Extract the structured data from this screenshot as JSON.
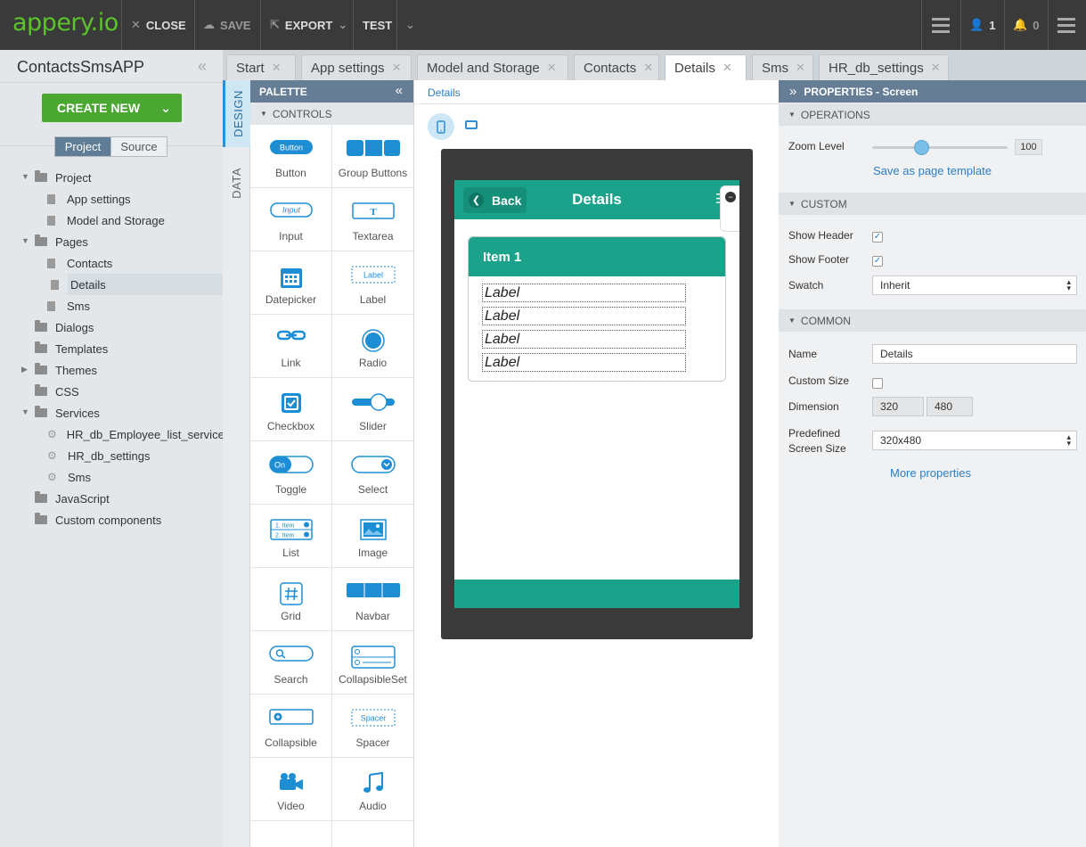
{
  "topbar": {
    "logo": "appery.io",
    "close": "CLOSE",
    "save": "SAVE",
    "export": "EXPORT",
    "test": "TEST",
    "users_count": "1",
    "notifications_count": "0"
  },
  "tabs": [
    "Start",
    "App settings",
    "Model and Storage",
    "Contacts",
    "Details",
    "Sms",
    "HR_db_settings"
  ],
  "active_tab": "Details",
  "sidebar": {
    "project_name": "ContactsSmsAPP",
    "create_new": "CREATE NEW",
    "seg_project": "Project",
    "seg_source": "Source",
    "tree": [
      {
        "label": "Project",
        "type": "folder",
        "expanded": true
      },
      {
        "label": "App settings",
        "type": "doc"
      },
      {
        "label": "Model and Storage",
        "type": "doc"
      },
      {
        "label": "Pages",
        "type": "folder",
        "expanded": true
      },
      {
        "label": "Contacts",
        "type": "doc"
      },
      {
        "label": "Details",
        "type": "doc",
        "selected": true
      },
      {
        "label": "Sms",
        "type": "doc"
      },
      {
        "label": "Dialogs",
        "type": "folder"
      },
      {
        "label": "Templates",
        "type": "folder"
      },
      {
        "label": "Themes",
        "type": "folder",
        "collapsed": true
      },
      {
        "label": "CSS",
        "type": "folder"
      },
      {
        "label": "Services",
        "type": "folder",
        "expanded": true
      },
      {
        "label": "HR_db_Employee_list_service",
        "type": "gear"
      },
      {
        "label": "HR_db_settings",
        "type": "gear"
      },
      {
        "label": "Sms",
        "type": "gear"
      },
      {
        "label": "JavaScript",
        "type": "folder"
      },
      {
        "label": "Custom components",
        "type": "folder"
      }
    ]
  },
  "vtabs": {
    "design": "DESIGN",
    "data": "DATA"
  },
  "palette": {
    "title": "PALETTE",
    "section": "CONTROLS",
    "items": [
      {
        "label": "Button",
        "icon": "button-icon"
      },
      {
        "label": "Group Buttons",
        "icon": "group-buttons-icon"
      },
      {
        "label": "Input",
        "icon": "input-icon"
      },
      {
        "label": "Textarea",
        "icon": "textarea-icon"
      },
      {
        "label": "Datepicker",
        "icon": "calendar-icon"
      },
      {
        "label": "Label",
        "icon": "label-icon"
      },
      {
        "label": "Link",
        "icon": "link-icon"
      },
      {
        "label": "Radio",
        "icon": "radio-icon"
      },
      {
        "label": "Checkbox",
        "icon": "checkbox-icon"
      },
      {
        "label": "Slider",
        "icon": "slider-icon"
      },
      {
        "label": "Toggle",
        "icon": "toggle-icon"
      },
      {
        "label": "Select",
        "icon": "select-icon"
      },
      {
        "label": "List",
        "icon": "list-icon"
      },
      {
        "label": "Image",
        "icon": "image-icon"
      },
      {
        "label": "Grid",
        "icon": "grid-icon"
      },
      {
        "label": "Navbar",
        "icon": "navbar-icon"
      },
      {
        "label": "Search",
        "icon": "search-icon"
      },
      {
        "label": "CollapsibleSet",
        "icon": "collapsibleset-icon"
      },
      {
        "label": "Collapsible",
        "icon": "collapsible-icon"
      },
      {
        "label": "Spacer",
        "icon": "spacer-icon"
      },
      {
        "label": "Video",
        "icon": "video-icon"
      },
      {
        "label": "Audio",
        "icon": "audio-icon"
      }
    ],
    "icon_text": {
      "button": "Button",
      "input": "Input",
      "label": "Label",
      "toggle": "On",
      "list_item1": "1. Item",
      "list_item2": "2. Item",
      "spacer": "Spacer",
      "textarea": "T"
    }
  },
  "canvas": {
    "breadcrumb": "Details",
    "header_title": "Details",
    "back_label": "Back",
    "collapsible_title": "Item 1",
    "labels": [
      "Label",
      "Label",
      "Label",
      "Label"
    ]
  },
  "properties": {
    "title": "PROPERTIES - Screen",
    "operations": "OPERATIONS",
    "zoom_label": "Zoom Level",
    "zoom_value": "100",
    "save_template": "Save as page template",
    "custom": "CUSTOM",
    "show_header": "Show Header",
    "show_header_checked": true,
    "show_footer": "Show Footer",
    "show_footer_checked": true,
    "swatch_label": "Swatch",
    "swatch_value": "Inherit",
    "common": "COMMON",
    "name_label": "Name",
    "name_value": "Details",
    "custom_size_label": "Custom Size",
    "custom_size_checked": false,
    "dimension_label": "Dimension",
    "dim_w": "320",
    "dim_h": "480",
    "predefined_label_1": "Predefined",
    "predefined_label_2": "Screen Size",
    "predefined_value": "320x480",
    "more": "More properties"
  },
  "colors": {
    "brand_green": "#5cc32d",
    "create_green": "#4aa832",
    "teal": "#1aa38a",
    "accent_blue": "#2d8fd5",
    "header_slate": "#667d96"
  }
}
